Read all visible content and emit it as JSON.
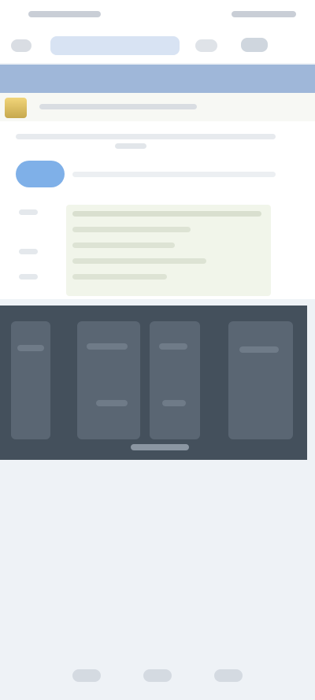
{
  "app": {
    "background": "#eef2f6",
    "accent_bar_color": "#9fb7d9",
    "panel_color": "#44505c"
  },
  "status_bar": {
    "icons": [
      "time",
      "signal-icon",
      "wifi-icon",
      "battery-icon"
    ]
  },
  "toolbar": {
    "icons": [
      "menu-icon",
      "address-bar",
      "tabs-icon",
      "more-icon"
    ]
  },
  "content": {
    "ad_icon": "thumbnail-icon",
    "chip_color": "#7fb0e8",
    "code_bg": "#f1f5ea"
  },
  "nav": {
    "buttons": [
      "back-button",
      "home-button",
      "recents-button"
    ]
  }
}
